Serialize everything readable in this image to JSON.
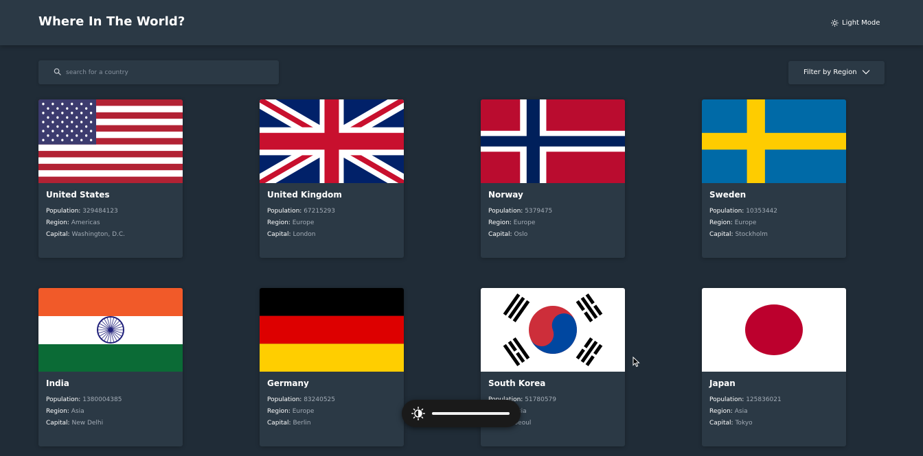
{
  "header": {
    "title": "Where In The World?",
    "mode_label": "Light Mode",
    "mode_icon": "sun-icon"
  },
  "search": {
    "placeholder": "search for a country",
    "value": "",
    "icon": "search-icon"
  },
  "filter": {
    "label": "Filter by Region",
    "icon": "chevron-down-icon"
  },
  "labels": {
    "population": "Population:",
    "region": "Region:",
    "capital": "Capital:"
  },
  "countries": [
    {
      "name": "United States",
      "population": "329484123",
      "region": "Americas",
      "capital": "Washington, D.C.",
      "flag": "us-flag"
    },
    {
      "name": "United Kingdom",
      "population": "67215293",
      "region": "Europe",
      "capital": "London",
      "flag": "uk-flag"
    },
    {
      "name": "Norway",
      "population": "5379475",
      "region": "Europe",
      "capital": "Oslo",
      "flag": "norway-flag"
    },
    {
      "name": "Sweden",
      "population": "10353442",
      "region": "Europe",
      "capital": "Stockholm",
      "flag": "sweden-flag"
    },
    {
      "name": "India",
      "population": "1380004385",
      "region": "Asia",
      "capital": "New Delhi",
      "flag": "india-flag"
    },
    {
      "name": "Germany",
      "population": "83240525",
      "region": "Europe",
      "capital": "Berlin",
      "flag": "germany-flag"
    },
    {
      "name": "South Korea",
      "population": "51780579",
      "region": "Asia",
      "capital": "Seoul",
      "flag": "south-korea-flag"
    },
    {
      "name": "Japan",
      "population": "125836021",
      "region": "Asia",
      "capital": "Tokyo",
      "flag": "japan-flag"
    }
  ],
  "brightness": {
    "level": 1.0,
    "icon": "brightness-icon"
  },
  "colors": {
    "background": "#202c37",
    "elements": "#2b3945",
    "text": "#ffffff",
    "muted_text": "#a3acb6"
  }
}
